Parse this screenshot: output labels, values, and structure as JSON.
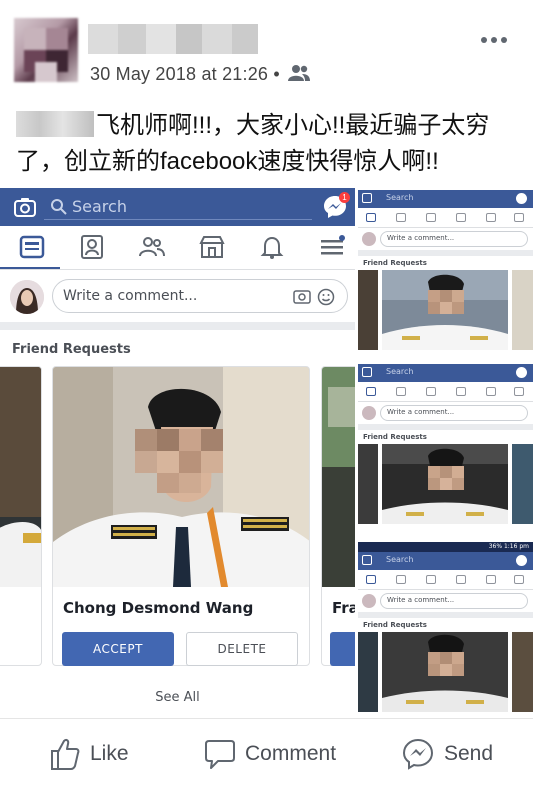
{
  "post": {
    "timestamp": "30 May 2018 at 21:26",
    "separator": "•",
    "audience_icon": "friends-icon",
    "more_icon": "more-options-icon",
    "text_line1": "飞机师啊!!!，大家小心!!最近骗子太穷",
    "text_line2": "了，创立新的facebook速度快得惊人啊!!"
  },
  "screenshot_main": {
    "search_placeholder": "Search",
    "messenger_badge": "1",
    "compose_placeholder": "Write a comment...",
    "friend_requests_header": "Friend Requests",
    "card_name": "Chong Desmond Wang",
    "side_card_name": "Fra",
    "accept_label": "ACCEPT",
    "delete_label": "DELETE",
    "see_all_label": "See All"
  },
  "mini_shots": [
    {
      "search_placeholder": "Search",
      "compose_placeholder": "Write a comment...",
      "header": "Friend Requests"
    },
    {
      "search_placeholder": "Search",
      "compose_placeholder": "Write a comment...",
      "header": "Friend Requests"
    },
    {
      "search_placeholder": "Search",
      "compose_placeholder": "Write a comment...",
      "header": "Friend Requests",
      "status_text": "36% 1:16 pm"
    }
  ],
  "actions": {
    "like_label": "Like",
    "comment_label": "Comment",
    "send_label": "Send"
  },
  "colors": {
    "facebook_blue": "#3b5998",
    "button_blue": "#4267b2",
    "badge_red": "#fa3e3e"
  }
}
